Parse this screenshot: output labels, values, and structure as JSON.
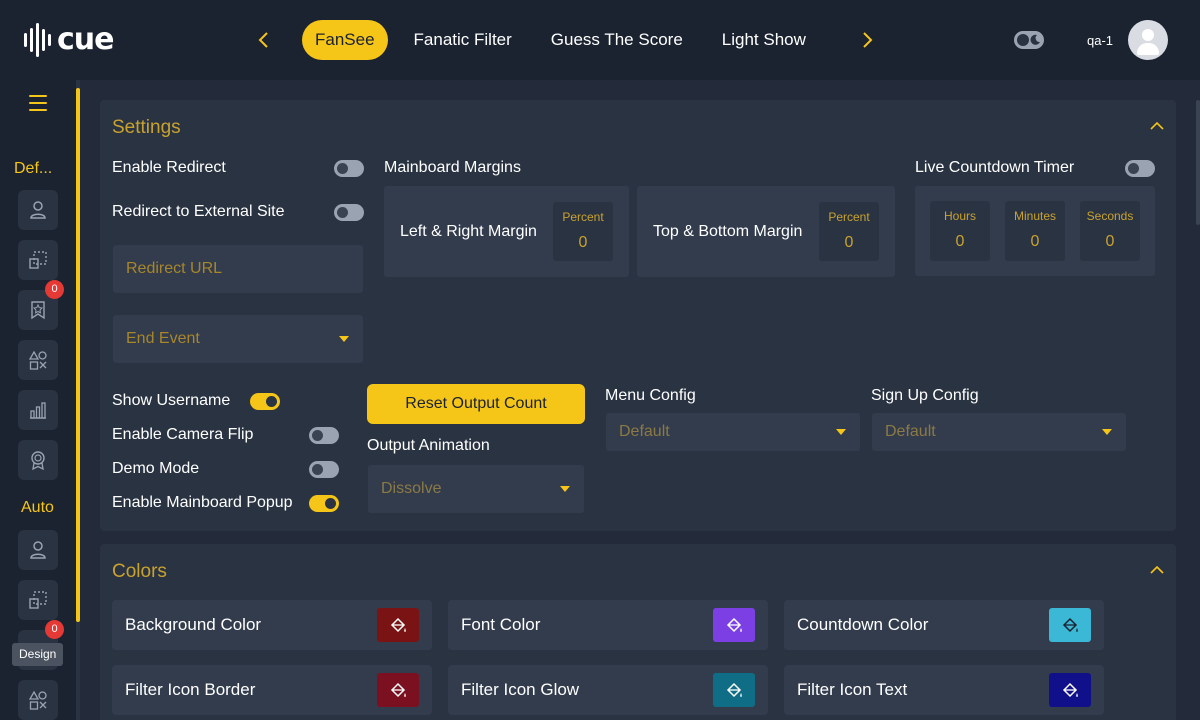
{
  "app": {
    "logo_text": "cue",
    "username": "qa-1"
  },
  "nav": {
    "tabs": [
      {
        "label": "FanSee",
        "active": true
      },
      {
        "label": "Fanatic Filter",
        "active": false
      },
      {
        "label": "Guess The Score",
        "active": false
      },
      {
        "label": "Light Show",
        "active": false
      }
    ],
    "prev_icon": "chevron-left-icon",
    "next_icon": "chevron-right-icon"
  },
  "sidebar": {
    "group_default_label": "Def...",
    "group_auto_label": "Auto",
    "badge_count_1": "0",
    "badge_count_2": "0",
    "tooltip": "Design",
    "icons": [
      "user-icon",
      "crop-icon",
      "ribbon-icon",
      "shapes-icon",
      "bar-chart-icon",
      "award-icon"
    ]
  },
  "settings": {
    "title": "Settings",
    "enable_redirect_label": "Enable Redirect",
    "enable_redirect": false,
    "redirect_external_label": "Redirect to External Site",
    "redirect_external": false,
    "redirect_url_placeholder": "Redirect URL",
    "end_event_placeholder": "End Event",
    "mainboard_margins_label": "Mainboard Margins",
    "left_right_label": "Left & Right Margin",
    "left_right_unit": "Percent",
    "left_right_value": "0",
    "top_bottom_label": "Top & Bottom Margin",
    "top_bottom_unit": "Percent",
    "top_bottom_value": "0",
    "countdown_label": "Live Countdown Timer",
    "countdown_enabled": false,
    "hours_label": "Hours",
    "hours_value": "0",
    "minutes_label": "Minutes",
    "minutes_value": "0",
    "seconds_label": "Seconds",
    "seconds_value": "0",
    "show_username_label": "Show Username",
    "show_username": true,
    "camera_flip_label": "Enable Camera Flip",
    "camera_flip": false,
    "demo_mode_label": "Demo Mode",
    "demo_mode": false,
    "mainboard_popup_label": "Enable Mainboard Popup",
    "mainboard_popup": true,
    "reset_button": "Reset Output Count",
    "output_animation_label": "Output Animation",
    "output_animation_value": "Dissolve",
    "menu_config_label": "Menu Config",
    "menu_config_value": "Default",
    "signup_config_label": "Sign Up Config",
    "signup_config_value": "Default"
  },
  "colors": {
    "title": "Colors",
    "items": [
      {
        "label": "Background Color",
        "color": "#7a1414"
      },
      {
        "label": "Font Color",
        "color": "#7b3fe4"
      },
      {
        "label": "Countdown Color",
        "color": "#3bb8d6"
      },
      {
        "label": "Filter Icon Border",
        "color": "#7a1020"
      },
      {
        "label": "Filter Icon Glow",
        "color": "#0f6e86"
      },
      {
        "label": "Filter Icon Text",
        "color": "#10108a"
      }
    ]
  },
  "theme": {
    "accent": "#f5c518",
    "background": "#1b2230",
    "panel": "#2a3342"
  }
}
